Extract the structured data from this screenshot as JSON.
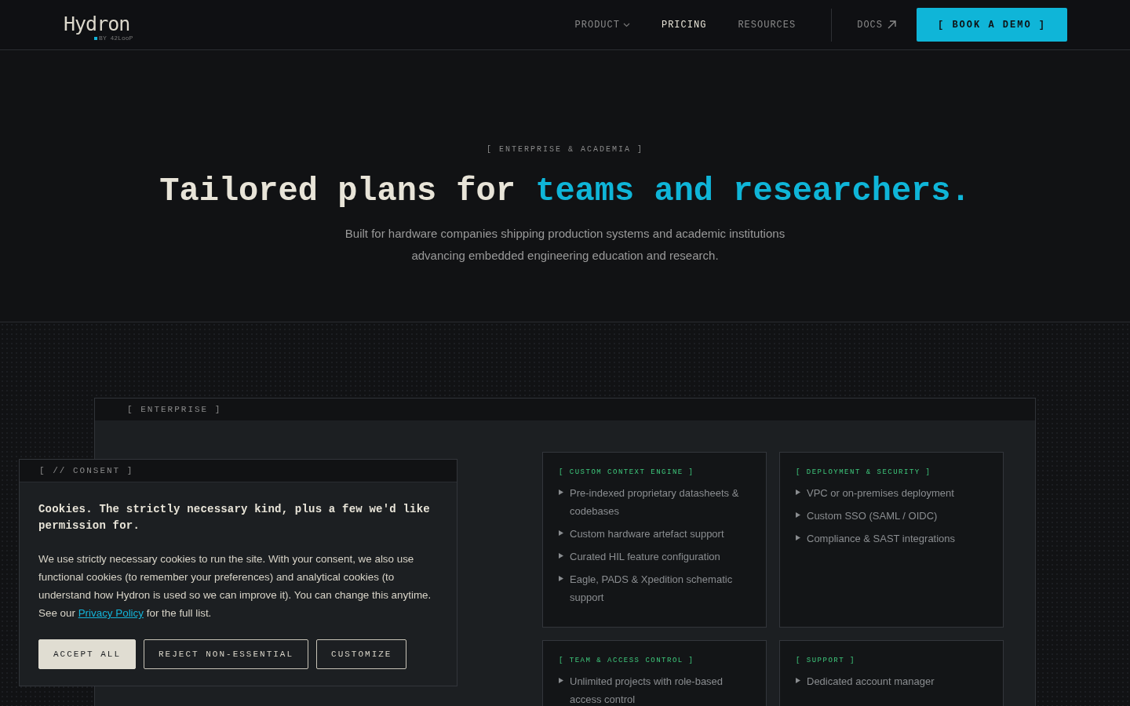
{
  "logo": {
    "name": "Hydron",
    "byline": "BY 42LooP"
  },
  "nav": {
    "links": [
      {
        "label": "PRODUCT",
        "selected": false,
        "dropdown": true
      },
      {
        "label": "PRICING",
        "selected": true,
        "dropdown": false
      },
      {
        "label": "RESOURCES",
        "selected": false,
        "dropdown": false
      }
    ],
    "docs": "DOCS",
    "cta": "[ BOOK A DEMO ]"
  },
  "hero": {
    "eyebrow": "[ ENTERPRISE & ACADEMIA ]",
    "title_start": "Tailored plans for",
    "title_highlight": "teams and researchers.",
    "subtitle": "Built for hardware companies shipping production systems and academic institutions advancing embedded engineering education and research."
  },
  "plan_card": {
    "tag": "[ ENTERPRISE ]",
    "feature_groups": [
      {
        "title": "[ CUSTOM CONTEXT ENGINE ]",
        "items": [
          "Pre-indexed proprietary datasheets & codebases",
          "Custom hardware artefact support",
          "Curated HIL feature configuration",
          "Eagle, PADS & Xpedition schematic support"
        ]
      },
      {
        "title": "[ DEPLOYMENT & SECURITY ]",
        "items": [
          "VPC or on-premises deployment",
          "Custom SSO (SAML / OIDC)",
          "Compliance & SAST integrations"
        ]
      },
      {
        "title": "[ TEAM & ACCESS CONTROL ]",
        "items": [
          "Unlimited projects with role-based access control"
        ]
      },
      {
        "title": "[ SUPPORT ]",
        "items": [
          "Dedicated account manager"
        ]
      }
    ]
  },
  "cookie_banner": {
    "tag": "[ // CONSENT ]",
    "heading": "Cookies. The strictly necessary kind, plus a few we'd like permission for.",
    "body_start": "We use strictly necessary cookies to run the site. With your consent, we also use functional cookies (to remember your preferences) and analytical cookies (to understand how Hydron is used so we can improve it). You can change this anytime. See our",
    "link": "Privacy Policy",
    "body_end": "for the full list.",
    "buttons": [
      {
        "label": "ACCEPT ALL",
        "kind": "primary"
      },
      {
        "label": "REJECT NON-ESSENTIAL",
        "kind": "outline"
      },
      {
        "label": "CUSTOMIZE",
        "kind": "outline"
      }
    ]
  }
}
